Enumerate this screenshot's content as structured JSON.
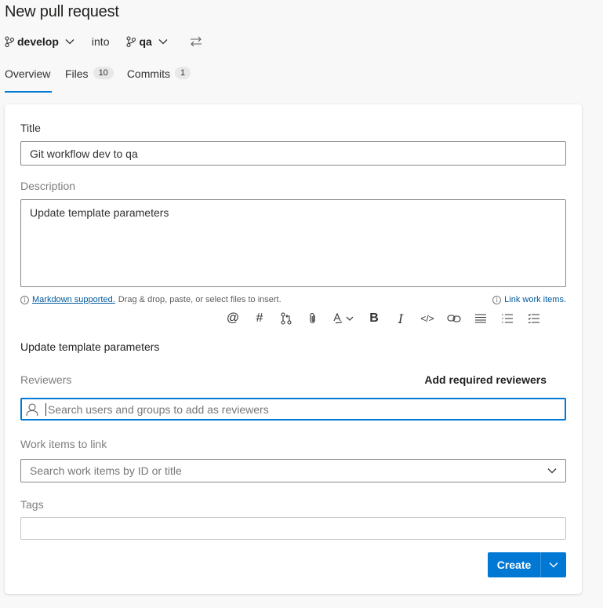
{
  "header": {
    "title": "New pull request"
  },
  "branches": {
    "source": "develop",
    "into": "into",
    "target": "qa"
  },
  "tabs": [
    {
      "label": "Overview"
    },
    {
      "label": "Files",
      "count": "10"
    },
    {
      "label": "Commits",
      "count": "1"
    }
  ],
  "form": {
    "title_label": "Title",
    "title_value": "Git workflow dev to qa",
    "description_label": "Description",
    "description_value": "Update template parameters",
    "markdown_link": "Markdown supported.",
    "markdown_hint": "Drag & drop, paste, or select files to insert.",
    "link_work_items": "Link work items.",
    "preview_text": "Update template parameters",
    "reviewers_label": "Reviewers",
    "add_required_reviewers": "Add required reviewers",
    "reviewers_placeholder": "Search users and groups to add as reviewers",
    "work_items_label": "Work items to link",
    "work_items_placeholder": "Search work items by ID or title",
    "tags_label": "Tags",
    "tags_value": "",
    "create_button": "Create"
  },
  "toolbar_icons": [
    "mention-icon",
    "hashtag-icon",
    "pull-request-icon",
    "attachment-icon",
    "format-icon",
    "bold-icon",
    "italic-icon",
    "code-icon",
    "link-icon",
    "bulleted-list-icon",
    "numbered-list-icon",
    "checklist-icon"
  ],
  "colors": {
    "accent": "#0078d4",
    "background": "#f8f8f8",
    "card": "#ffffff"
  }
}
